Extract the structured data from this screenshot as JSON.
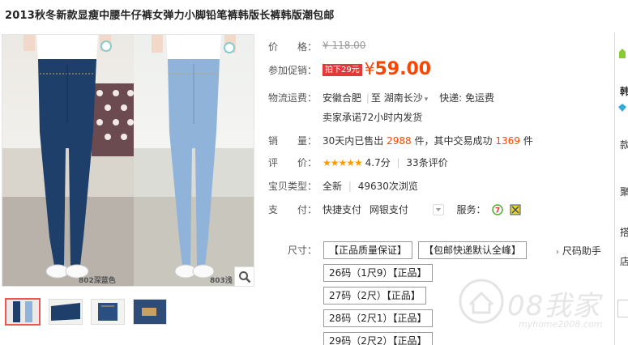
{
  "title": "2013秋冬新款显瘦中腰牛仔裤女弹力小脚铅笔裤韩版长裤韩版潮包邮",
  "image": {
    "caption_left": "802深蓝色",
    "caption_right": "803浅"
  },
  "price": {
    "label": "价　　格：",
    "original": "¥ 118.00"
  },
  "promo": {
    "label": "参加促销：",
    "tag": "拍下29元",
    "currency": "¥",
    "price": "59.00"
  },
  "shipping": {
    "label": "物流运费：",
    "from": "安徽合肥",
    "to": "湖南长沙",
    "express": "快递: 免运费",
    "promise": "卖家承诺72小时内发货"
  },
  "sales": {
    "label": "销　　量：",
    "prefix": "30天内已售出",
    "sold": "2988",
    "middle": "件，其中交易成功",
    "success": "1369",
    "suffix": "件"
  },
  "rating": {
    "label": "评　　价：",
    "stars": "★★★★★",
    "score": "4.7分",
    "reviews": "33条评价"
  },
  "item_type": {
    "label": "宝贝类型：",
    "condition": "全新",
    "views": "49630次浏览"
  },
  "payment": {
    "label": "支　　付：",
    "method1": "快捷支付",
    "method2": "网银支付",
    "service_label": "服务："
  },
  "sku": {
    "label": "尺寸：",
    "options": [
      "【正品质量保证】",
      "【包邮快递默认全峰】",
      "26码（1尺9）【正品】",
      "27码（2尺）【正品】",
      "28码（2尺1）【正品】",
      "29码（2尺2）【正品】"
    ],
    "size_helper": "尺码助手"
  },
  "right_edge": [
    "韩",
    "款",
    "聚",
    "搭",
    "店"
  ],
  "watermark": {
    "brand": "08我家",
    "url": "myhome2008.com"
  },
  "colors": {
    "accent": "#ff4400",
    "promo_tag": "#e4393c",
    "star": "#ff9900"
  }
}
